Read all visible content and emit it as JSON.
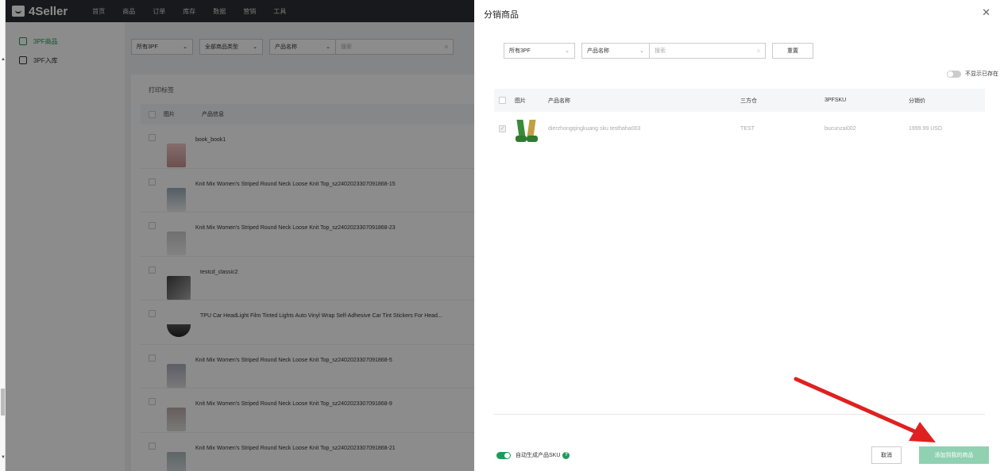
{
  "app": {
    "logo_text": "4Seller",
    "nav": [
      "首页",
      "商品",
      "订单",
      "库存",
      "数据",
      "营销",
      "工具"
    ]
  },
  "sidebar": {
    "items": [
      {
        "label": "3PF商品",
        "active": true
      },
      {
        "label": "3PF入库",
        "active": false
      }
    ]
  },
  "background": {
    "filters": {
      "warehouse": "所有3PF",
      "type": "全部商品类型",
      "field": "产品名称",
      "search_placeholder": "搜索"
    },
    "card_title": "打印标签",
    "table": {
      "headers": [
        "图片",
        "产品信息"
      ],
      "rows": [
        "book_book1",
        "Knit Mix Women's Striped Round Neck Loose Knit Top_sz2402023307091868-15",
        "Knit Mix Women's Striped Round Neck Loose Knit Top_sz2402023307091868-23",
        "testcd_classic2",
        "TPU Car HeadLight Film Tinted Lights Auto Vinyl Wrap Self-Adhesive Car Tint Stickers For Head...",
        "Knit Mix Women's Striped Round Neck Loose Knit Top_sz2402023307091868-5",
        "Knit Mix Women's Striped Round Neck Loose Knit Top_sz2402023307091868-9",
        "Knit Mix Women's Striped Round Neck Loose Knit Top_sz2402023307091868-21"
      ]
    }
  },
  "drawer": {
    "title": "分销商品",
    "filters": {
      "warehouse": "所有3PF",
      "field": "产品名称",
      "search_placeholder": "搜索",
      "reset_label": "重置"
    },
    "hide_existing_label": "不显示已存在",
    "table": {
      "headers": [
        "图片",
        "产品名称",
        "三方仓",
        "3PFSKU",
        "分销价"
      ],
      "rows": [
        {
          "name": "dierzhongqingkuang sku testhaha003",
          "warehouse": "TEST",
          "sku": "bucunzai002",
          "price": "1999.99 USD"
        }
      ]
    },
    "footer": {
      "auto_sku_label": "自动生成产品SKU",
      "cancel_label": "取消",
      "add_label": "添加到我的商品"
    }
  },
  "colors": {
    "brand_green": "#1f9a5a",
    "add_button_disabled": "#8fd1b0",
    "annotation_arrow": "#e02020"
  }
}
